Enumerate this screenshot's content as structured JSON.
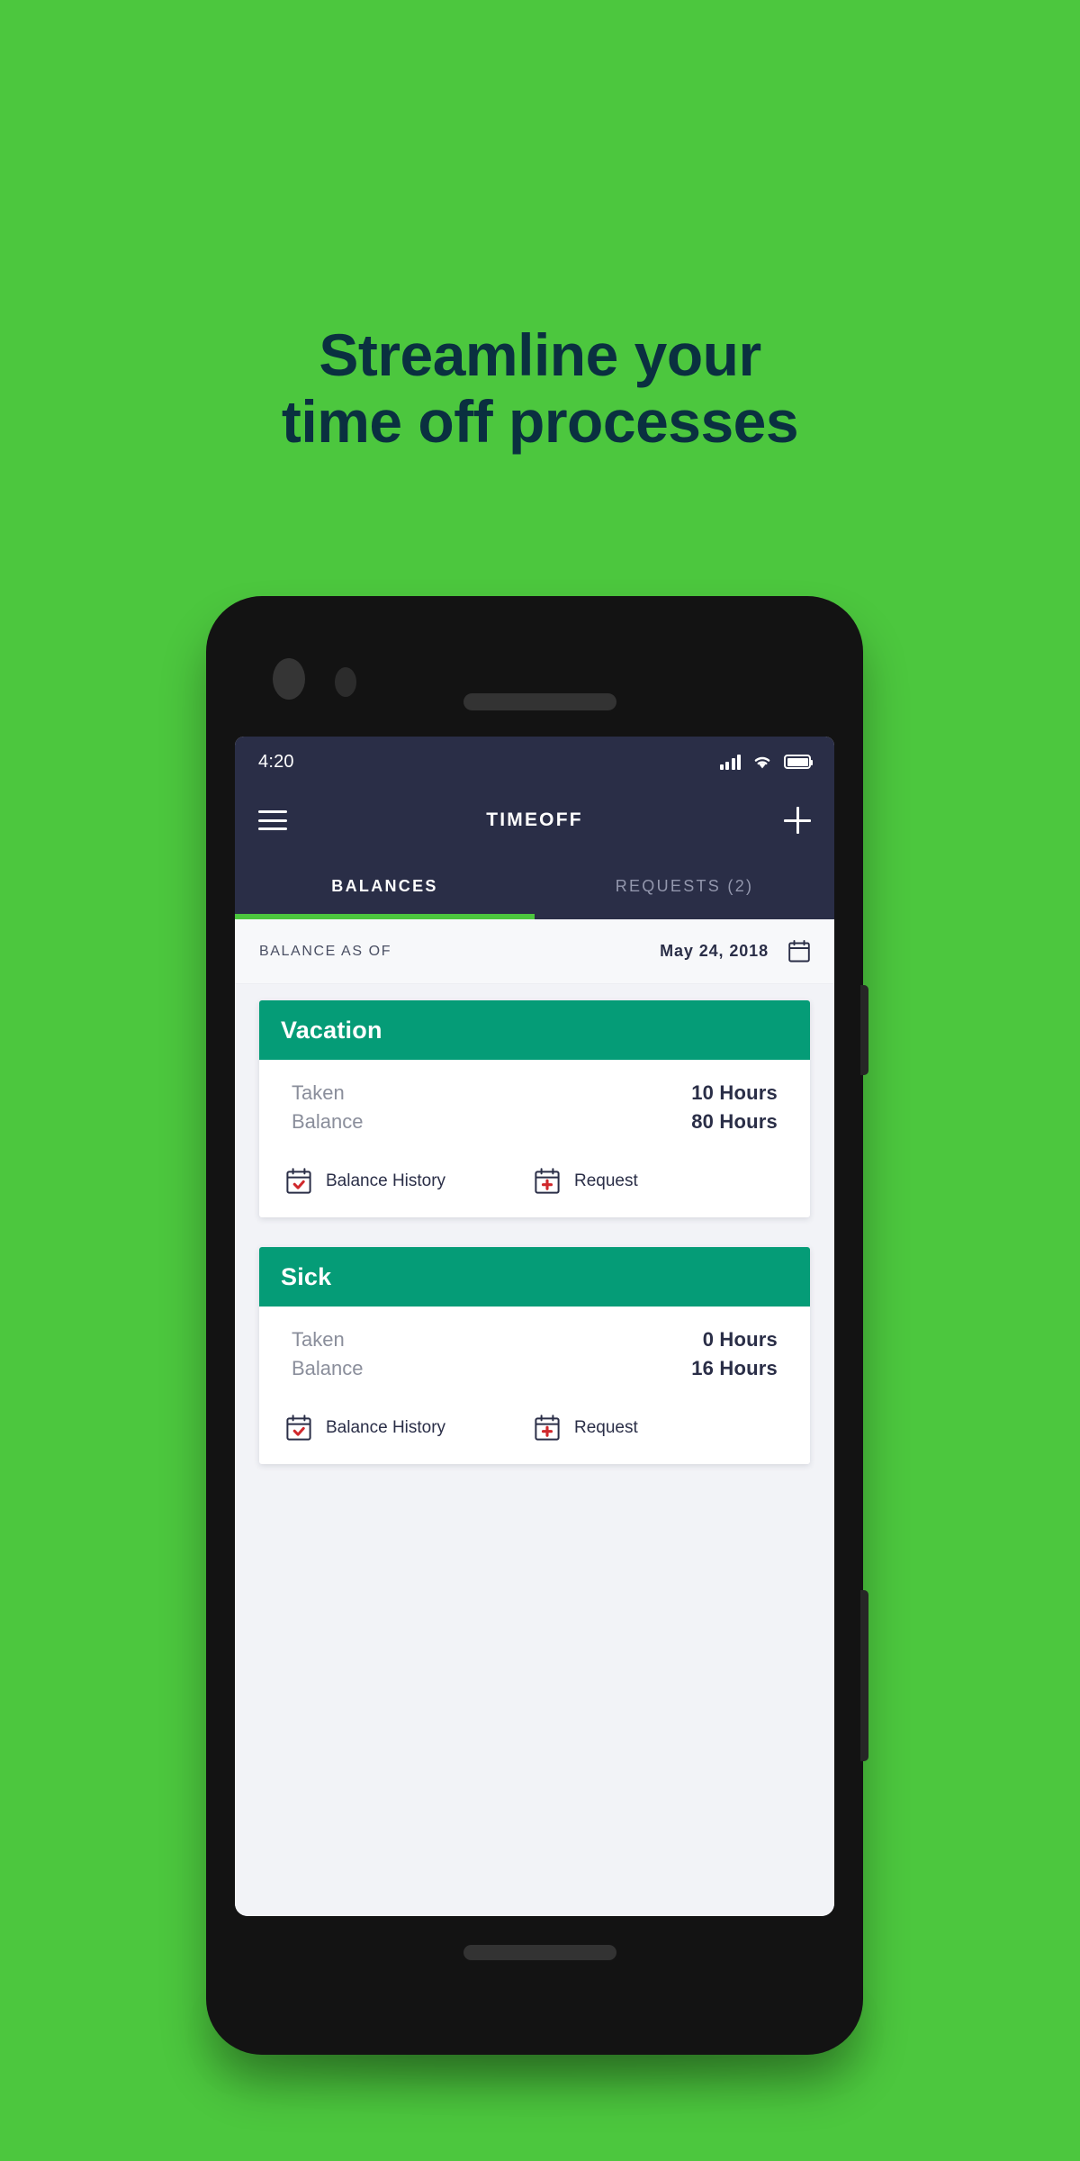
{
  "theme": {
    "background_green": "#4CC73E",
    "headline_navy": "#0A3040",
    "appbar_navy": "#2A2E47",
    "card_teal": "#059C77",
    "accent_red": "#D0282C",
    "screen_bg": "#F2F3F7"
  },
  "headline": {
    "line1": "Streamline your",
    "line2": "time off processes"
  },
  "phone": {
    "status_bar": {
      "time": "4:20",
      "icons": [
        "signal-icon",
        "wifi-icon",
        "battery-icon"
      ]
    },
    "app_bar": {
      "menu_icon": "hamburger-menu-icon",
      "title": "TIMEOFF",
      "add_icon": "plus-icon"
    },
    "tabs": [
      {
        "label": "BALANCES",
        "active": true
      },
      {
        "label": "REQUESTS (2)",
        "active": false
      }
    ],
    "balance_as_of": {
      "label": "BALANCE AS OF",
      "date": "May 24, 2018",
      "calendar_icon": "calendar-icon"
    },
    "cards": [
      {
        "title": "Vacation",
        "rows": [
          {
            "label": "Taken",
            "value": "10 Hours"
          },
          {
            "label": "Balance",
            "value": "80 Hours"
          }
        ],
        "actions": [
          {
            "label": "Balance History",
            "icon": "calendar-check-icon"
          },
          {
            "label": "Request",
            "icon": "calendar-plus-icon"
          }
        ]
      },
      {
        "title": "Sick",
        "rows": [
          {
            "label": "Taken",
            "value": "0 Hours"
          },
          {
            "label": "Balance",
            "value": "16 Hours"
          }
        ],
        "actions": [
          {
            "label": "Balance History",
            "icon": "calendar-check-icon"
          },
          {
            "label": "Request",
            "icon": "calendar-plus-icon"
          }
        ]
      }
    ]
  }
}
